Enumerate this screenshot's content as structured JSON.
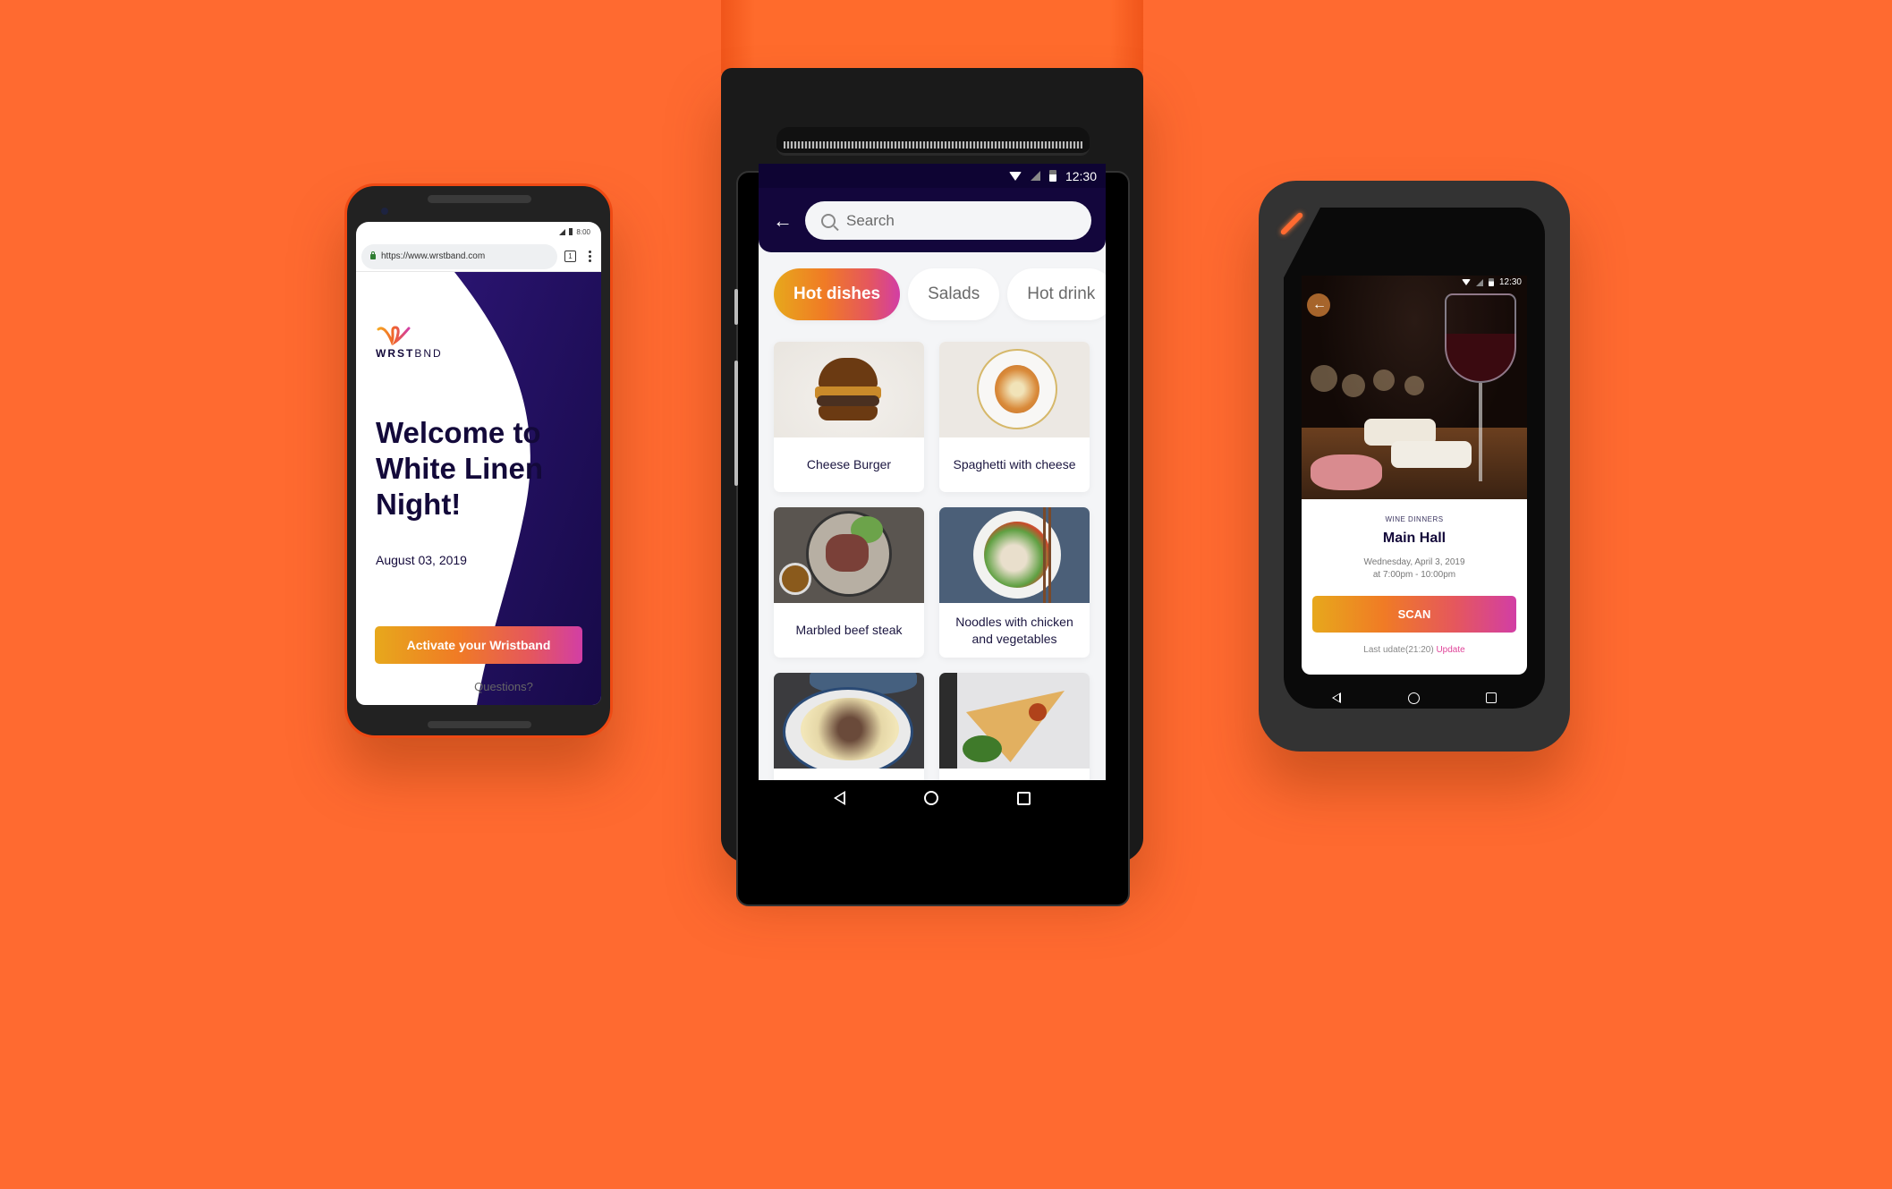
{
  "theme": {
    "background": "#ff6a30",
    "brand_navy": "#13093a",
    "gradient": [
      "#e7a81c",
      "#f07b25",
      "#e5575d",
      "#d23ea5"
    ],
    "link_pink": "#e0459a"
  },
  "left_phone": {
    "status_time": "8:00",
    "url": "https://www.wrstband.com",
    "tab_count": "1",
    "logo_text_bold": "WRST",
    "logo_text_light": "BND",
    "title": "Welcome to White Linen Night!",
    "date": "August 03, 2019",
    "cta_label": "Activate your Wristband",
    "questions_link": "Questions?"
  },
  "center_device": {
    "status_time": "12:30",
    "search_placeholder": "Search",
    "categories": [
      {
        "label": "Hot dishes",
        "active": true
      },
      {
        "label": "Salads",
        "active": false
      },
      {
        "label": "Hot drink",
        "active": false
      }
    ],
    "items": [
      {
        "name": "Cheese Burger",
        "image": "burger"
      },
      {
        "name": "Spaghetti with cheese",
        "image": "pasta"
      },
      {
        "name": "Marbled beef steak",
        "image": "steak"
      },
      {
        "name": "Noodles with chicken and vegetables",
        "image": "noodles"
      },
      {
        "name": "",
        "image": "fries"
      },
      {
        "name": "",
        "image": "pizza"
      }
    ]
  },
  "right_device": {
    "status_time": "12:30",
    "category": "WINE DINNERS",
    "title": "Main Hall",
    "date_line1": "Wednesday, April 3, 2019",
    "date_line2": "at 7:00pm - 10:00pm",
    "scan_label": "SCAN",
    "last_update_text": "Last udate(21:20)",
    "update_link": "Update"
  },
  "nav_icons": [
    "back-icon",
    "home-icon",
    "recents-icon"
  ]
}
